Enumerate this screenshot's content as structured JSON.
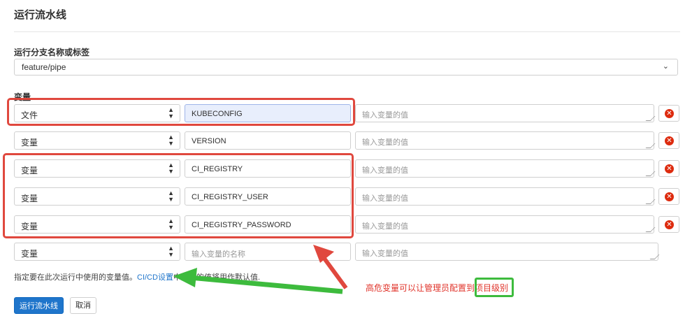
{
  "title": "运行流水线",
  "branch": {
    "label": "运行分支名称或标签",
    "value": "feature/pipe"
  },
  "variables": {
    "label": "变量",
    "rows": [
      {
        "type": "文件",
        "key": "KUBECONFIG",
        "value_placeholder": "输入变量的值"
      },
      {
        "type": "变量",
        "key": "VERSION",
        "value_placeholder": "输入变量的值"
      },
      {
        "type": "变量",
        "key": "CI_REGISTRY",
        "value_placeholder": "输入变量的值"
      },
      {
        "type": "变量",
        "key": "CI_REGISTRY_USER",
        "value_placeholder": "输入变量的值"
      },
      {
        "type": "变量",
        "key": "CI_REGISTRY_PASSWORD",
        "value_placeholder": "输入变量的值"
      }
    ],
    "empty_row": {
      "type": "变量",
      "key_placeholder": "输入变量的名称",
      "value_placeholder": "输入变量的值"
    }
  },
  "help": {
    "prefix": "指定要在此次运行中使用的变量值。",
    "link": "CI/CD设置",
    "mid": "中指定",
    "suffix": "的值将用作默认值."
  },
  "buttons": {
    "run": "运行流水线",
    "cancel": "取消"
  },
  "annotation": {
    "prefix": "高危变量可以让管理员配置到",
    "highlight": "项目级别"
  },
  "colors": {
    "primary": "#1f75cb",
    "danger": "#dd2b0e",
    "annotation_red": "#e0483e",
    "annotation_green": "#3dbb3d"
  }
}
